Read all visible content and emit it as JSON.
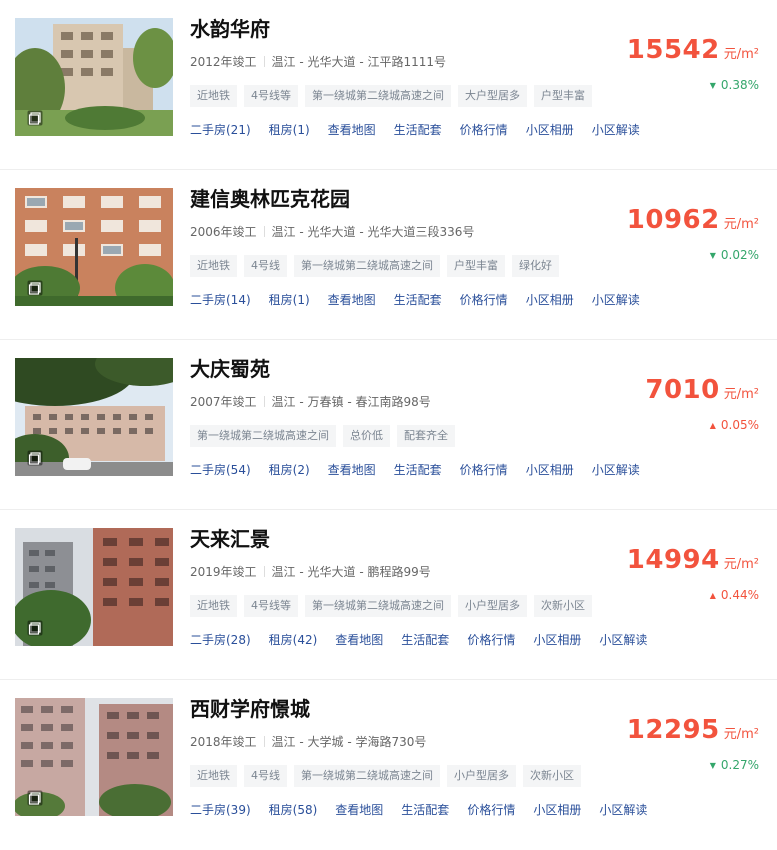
{
  "unit_label": "元/m²",
  "listings": [
    {
      "name": "水韵华府",
      "year": "2012年竣工",
      "location": "温江 - 光华大道 - 江平路1111号",
      "tags": [
        "近地铁",
        "4号线等",
        "第一绕城第二绕城高速之间",
        "大户型居多",
        "户型丰富"
      ],
      "links": [
        "二手房(21)",
        "租房(1)",
        "查看地图",
        "生活配套",
        "价格行情",
        "小区相册",
        "小区解读"
      ],
      "price": "15542",
      "change": "0.38%",
      "change_dir": "down",
      "photo": "garden-building"
    },
    {
      "name": "建信奥林匹克花园",
      "year": "2006年竣工",
      "location": "温江 - 光华大道 - 光华大道三段336号",
      "tags": [
        "近地铁",
        "4号线",
        "第一绕城第二绕城高速之间",
        "户型丰富",
        "绿化好"
      ],
      "links": [
        "二手房(14)",
        "租房(1)",
        "查看地图",
        "生活配套",
        "价格行情",
        "小区相册",
        "小区解读"
      ],
      "price": "10962",
      "change": "0.02%",
      "change_dir": "down",
      "photo": "orange-facade"
    },
    {
      "name": "大庆蜀苑",
      "year": "2007年竣工",
      "location": "温江 - 万春镇 - 春江南路98号",
      "tags": [
        "第一绕城第二绕城高速之间",
        "总价低",
        "配套齐全"
      ],
      "links": [
        "二手房(54)",
        "租房(2)",
        "查看地图",
        "生活配套",
        "价格行情",
        "小区相册",
        "小区解读"
      ],
      "price": "7010",
      "change": "0.05%",
      "change_dir": "up",
      "photo": "tree-street"
    },
    {
      "name": "天来汇景",
      "year": "2019年竣工",
      "location": "温江 - 光华大道 - 鹏程路99号",
      "tags": [
        "近地铁",
        "4号线等",
        "第一绕城第二绕城高速之间",
        "小户型居多",
        "次新小区"
      ],
      "links": [
        "二手房(28)",
        "租房(42)",
        "查看地图",
        "生活配套",
        "价格行情",
        "小区相册",
        "小区解读"
      ],
      "price": "14994",
      "change": "0.44%",
      "change_dir": "up",
      "photo": "highrise-grey"
    },
    {
      "name": "西财学府憬城",
      "year": "2018年竣工",
      "location": "温江 - 大学城 - 学海路730号",
      "tags": [
        "近地铁",
        "4号线",
        "第一绕城第二绕城高速之间",
        "小户型居多",
        "次新小区"
      ],
      "links": [
        "二手房(39)",
        "租房(58)",
        "查看地图",
        "生活配套",
        "价格行情",
        "小区相册",
        "小区解读"
      ],
      "price": "12295",
      "change": "0.27%",
      "change_dir": "down",
      "photo": "highrise-pink"
    }
  ]
}
